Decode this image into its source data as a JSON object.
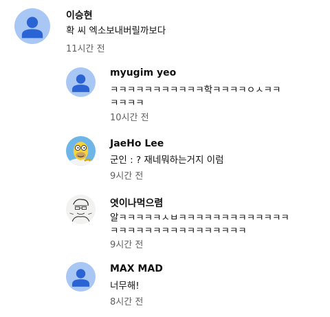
{
  "comments": [
    {
      "author": "이승현",
      "text_lines": [
        "확 씨 엑소보내버릴까보다"
      ],
      "time": "11시간 전",
      "avatar_icon": "default-profile-icon"
    },
    {
      "author": "myugim yeo",
      "text_lines": [
        "ㅋㅋㅋㅋㅋㅋㅋㅋㅋㅋㅋ학ㅋㅋㅋㅋㅇㅅㅋㅋ",
        "ㅋㅋㅋㅋ"
      ],
      "time": "10시간 전",
      "avatar_icon": "default-profile-icon"
    },
    {
      "author": "JaeHo Lee",
      "text_lines": [
        "군인 : ? 재네뭐하는거지 이럼"
      ],
      "time": "9시간 전",
      "avatar_icon": "cartoon-character-avatar-icon"
    },
    {
      "author": "엿이나먹으렴",
      "text_lines": [
        "알ㅋㅋㅋㅋㅋㅅㅂㅋㅋㅋㅋㅋㅋㅋㅋㅋㅋㅋㅋㅋ",
        "ㅋㅋㅋㅋㅋㅋㅋㅋㅋㅋㅋㅋㅋㅋㅋㅋ"
      ],
      "time": "9시간 전",
      "avatar_icon": "sketch-drawing-avatar-icon"
    },
    {
      "author": "MAX MAD",
      "text_lines": [
        "너무해!"
      ],
      "time": "8시간 전",
      "avatar_icon": "default-profile-icon"
    }
  ],
  "colors": {
    "default_avatar_bg": "#a9c7f5",
    "default_avatar_fg": "#2a63d4",
    "author_text": "#111111",
    "time_text": "#606060"
  }
}
